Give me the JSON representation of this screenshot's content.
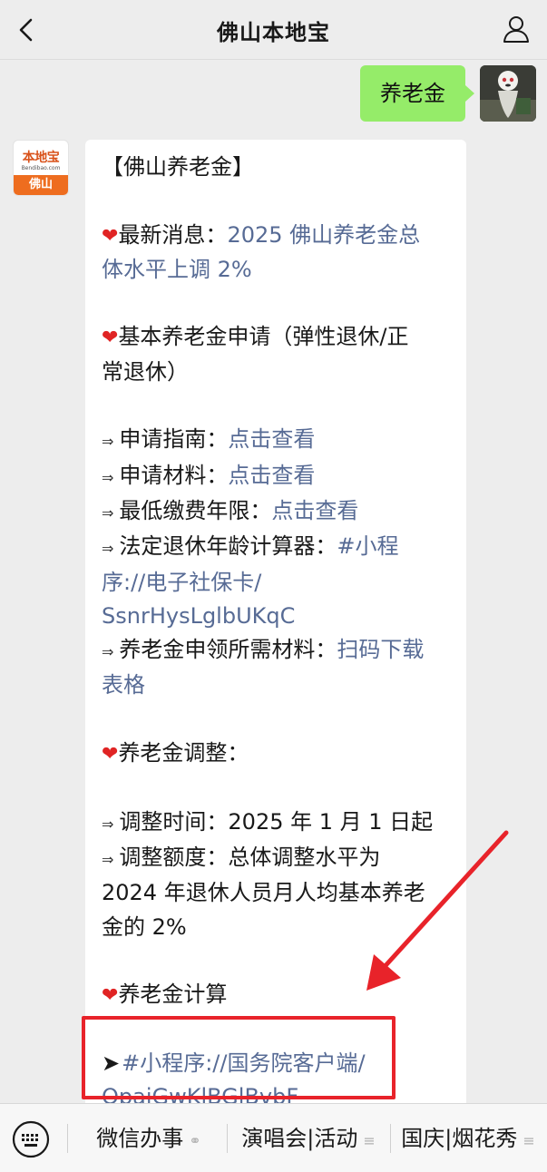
{
  "header": {
    "title": "佛山本地宝"
  },
  "outgoing": {
    "text": "养老金"
  },
  "bot": {
    "logo_text": "本地宝",
    "logo_sub": "Bendibao.com",
    "logo_city": "佛山"
  },
  "message": {
    "title": "【佛山养老金】",
    "news_label": "最新消息：",
    "news_link_1": "2025 佛山养老金总",
    "news_link_2": "体水平上调 2%",
    "apply_heading_1": "基本养老金申请（弹性退休/正",
    "apply_heading_2": "常退休）",
    "guide_label": "申请指南：",
    "guide_link": "点击查看",
    "materials_label": "申请材料：",
    "materials_link": "点击查看",
    "min_years_label": "最低缴费年限：",
    "min_years_link": "点击查看",
    "calc_label": "法定退休年龄计算器：",
    "calc_link_1": "#小程",
    "calc_link_2": "序://电子社保卡/",
    "calc_link_3": "SsnrHysLglbUKqC",
    "claim_label": "养老金申领所需材料：",
    "claim_link_1": "扫码下载",
    "claim_link_2": "表格",
    "adjust_heading": "养老金调整：",
    "adjust_time": "调整时间：2025 年 1 月 1 日起",
    "adjust_amount_1": "调整额度：总体调整水平为",
    "adjust_amount_2": "2024 年退休人员月人均基本养老",
    "adjust_amount_3": "金的 2%",
    "calc_heading": "养老金计算",
    "mini_link_1": "#小程序://国务院客户端/",
    "mini_link_2": "OpajGwKlBGlBvbF"
  },
  "bottom_menu": {
    "item1": "微信办事",
    "item2": "演唱会|活动",
    "item3": "国庆|烟花秀"
  },
  "colors": {
    "link": "#576b95",
    "bubble_out": "#95ec69",
    "highlight": "#e8232a"
  }
}
